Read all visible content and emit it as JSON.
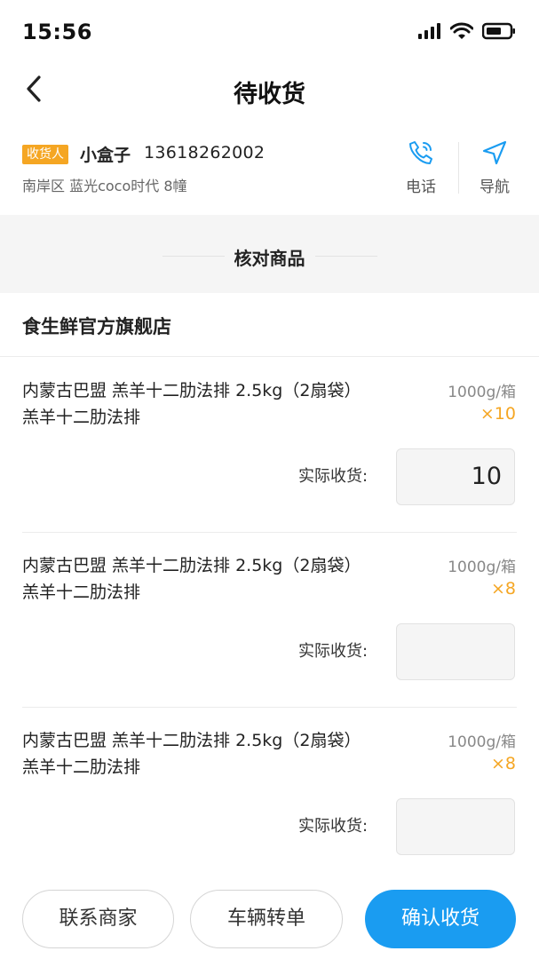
{
  "status_bar": {
    "time": "15:56"
  },
  "nav": {
    "title": "待收货"
  },
  "receiver": {
    "tag": "收货人",
    "name": "小盒子",
    "phone": "13618262002",
    "address": "南岸区 蓝光coco时代 8幢",
    "call_label": "电话",
    "navigate_label": "导航"
  },
  "verify": {
    "title": "核对商品"
  },
  "shop": {
    "name": "食生鲜官方旗舰店"
  },
  "items": [
    {
      "name": "内蒙古巴盟 羔羊十二肋法排 2.5kg（2扇袋）羔羊十二肋法排",
      "spec": "1000g/箱",
      "qty": "×10",
      "received_label": "实际收货:",
      "received_value": "10"
    },
    {
      "name": "内蒙古巴盟 羔羊十二肋法排 2.5kg（2扇袋）羔羊十二肋法排",
      "spec": "1000g/箱",
      "qty": "×8",
      "received_label": "实际收货:",
      "received_value": ""
    },
    {
      "name": "内蒙古巴盟 羔羊十二肋法排 2.5kg（2扇袋）羔羊十二肋法排",
      "spec": "1000g/箱",
      "qty": "×8",
      "received_label": "实际收货:",
      "received_value": ""
    }
  ],
  "footer": {
    "contact_label": "联系商家",
    "transfer_label": "车辆转单",
    "confirm_label": "确认收货"
  },
  "colors": {
    "accent_blue": "#1a9cf1",
    "tag_orange": "#f5a623",
    "qty_orange": "#f5a623"
  },
  "icons": [
    "signal-icon",
    "wifi-icon",
    "battery-icon",
    "back-arrow-icon",
    "phone-icon",
    "navigation-icon"
  ]
}
